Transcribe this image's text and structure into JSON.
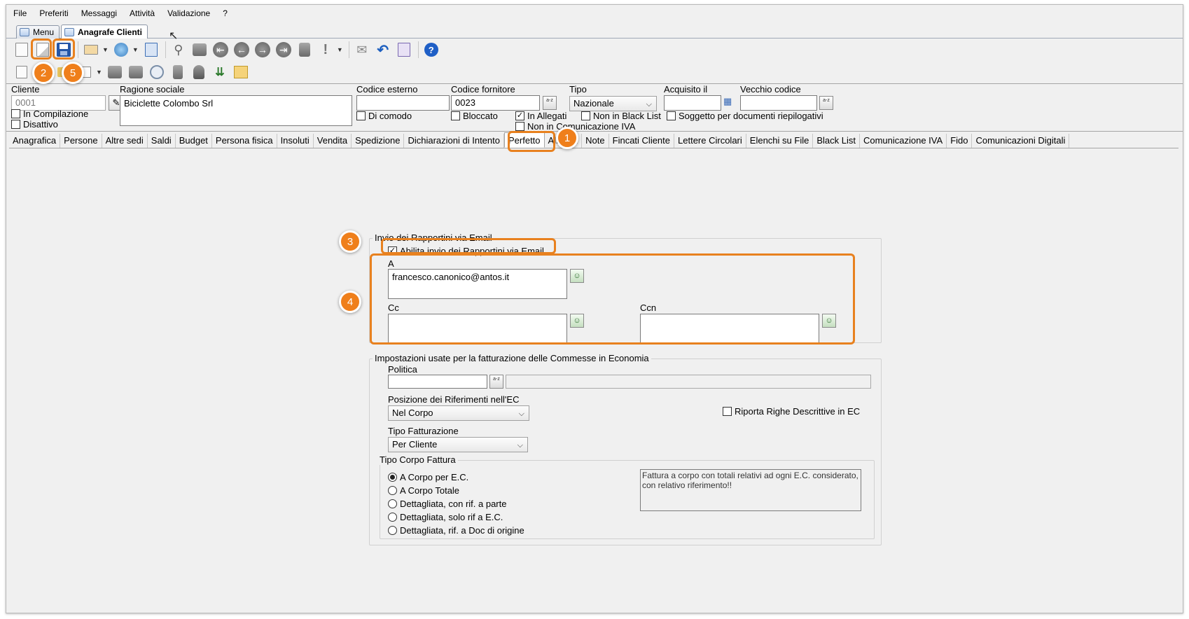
{
  "menubar": [
    "File",
    "Preferiti",
    "Messaggi",
    "Attività",
    "Validazione",
    "?"
  ],
  "window_tabs": [
    {
      "label": "Menu",
      "active": false
    },
    {
      "label": "Anagrafe Clienti",
      "active": true
    }
  ],
  "toolbar1_icons": [
    "new-icon",
    "edit-icon",
    "save-icon",
    "print-icon",
    "web-icon",
    "config-icon",
    "search-icon",
    "binoculars-icon",
    "first-icon",
    "prev-icon",
    "next-icon",
    "last-icon",
    "clipboard-icon",
    "alert-icon",
    "mail-icon",
    "undo-icon",
    "tools-icon",
    "help-icon"
  ],
  "toolbar2_icons": [
    "copy-icon",
    "contact-icon",
    "folder-icon",
    "printer-icon",
    "network-icon",
    "bank-icon",
    "compass-icon",
    "stamp-icon",
    "person-icon",
    "tree-icon",
    "chart-icon"
  ],
  "header": {
    "cliente_label": "Cliente",
    "cliente_value": "0001",
    "ragione_label": "Ragione sociale",
    "ragione_value": "Biciclette Colombo Srl",
    "codice_esterno_label": "Codice esterno",
    "codice_esterno_value": "",
    "codice_fornitore_label": "Codice fornitore",
    "codice_fornitore_value": "0023",
    "tipo_label": "Tipo",
    "tipo_value": "Nazionale",
    "acquisito_label": "Acquisito il",
    "acquisito_value": "",
    "vecchio_codice_label": "Vecchio codice",
    "vecchio_codice_value": "",
    "keybtn_text": "a-z"
  },
  "checks": {
    "in_compilazione": {
      "label": "In Compilazione",
      "checked": false
    },
    "disattivo": {
      "label": "Disattivo",
      "checked": false
    },
    "di_comodo": {
      "label": "Di comodo",
      "checked": false
    },
    "bloccato": {
      "label": "Bloccato",
      "checked": false
    },
    "in_allegati": {
      "label": "In Allegati",
      "checked": true
    },
    "non_black_list": {
      "label": "Non in Black List",
      "checked": false
    },
    "soggetto": {
      "label": "Soggetto per documenti riepilogativi",
      "checked": false
    },
    "non_comunicazione": {
      "label": "Non in Comunicazione IVA",
      "checked": false
    }
  },
  "tabs": [
    "Anagrafica",
    "Persone",
    "Altre sedi",
    "Saldi",
    "Budget",
    "Persona fisica",
    "Insoluti",
    "Vendita",
    "Spedizione",
    "Dichiarazioni di Intento",
    "Perfetto",
    "Allegati",
    "Note",
    "Fincati Cliente",
    "Lettere Circolari",
    "Elenchi su File",
    "Black List",
    "Comunicazione IVA",
    "Fido",
    "Comunicazioni Digitali"
  ],
  "active_tab": "Perfetto",
  "email_group": {
    "title": "Invio dei Rapportini via Email",
    "enable_label": "Abilita invio dei Rapportini via Email",
    "enable_checked": true,
    "a_label": "A",
    "a_value": "francesco.canonico@antos.it",
    "cc_label": "Cc",
    "cc_value": "",
    "ccn_label": "Ccn",
    "ccn_value": ""
  },
  "billing_group": {
    "title": "Impostazioni usate per la fatturazione delle Commesse in Economia",
    "politica_label": "Politica",
    "politica_value": "",
    "posizione_label": "Posizione dei Riferimenti nell'EC",
    "posizione_value": "Nel Corpo",
    "riporta_label": "Riporta Righe Descrittive in EC",
    "riporta_checked": false,
    "tipo_fatt_label": "Tipo Fatturazione",
    "tipo_fatt_value": "Per Cliente",
    "corpo_title": "Tipo Corpo Fattura",
    "corpo_options": [
      {
        "label": "A Corpo per E.C.",
        "selected": true
      },
      {
        "label": "A Corpo Totale",
        "selected": false
      },
      {
        "label": "Dettagliata, con rif. a parte",
        "selected": false
      },
      {
        "label": "Dettagliata, solo rif a E.C.",
        "selected": false
      },
      {
        "label": "Dettagliata, rif. a Doc di origine",
        "selected": false
      }
    ],
    "corpo_description": "Fattura a corpo con totali relativi ad ogni E.C. considerato, con relativo riferimento!!"
  },
  "callouts": [
    "1",
    "2",
    "3",
    "4",
    "5"
  ],
  "colors": {
    "accent": "#ef7f1b",
    "highlight_border": "#e8811f"
  }
}
